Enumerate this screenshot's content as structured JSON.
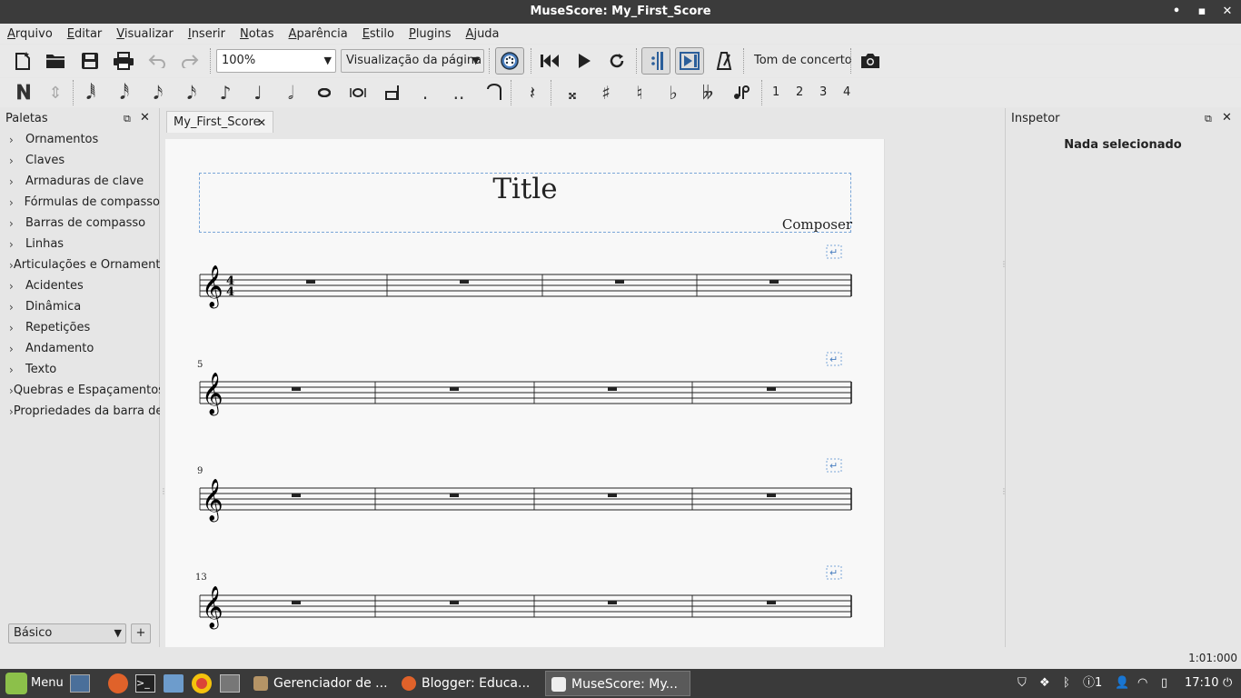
{
  "window": {
    "title": "MuseScore: My_First_Score",
    "minimize": "•",
    "maximize": "▪",
    "close": "✕"
  },
  "menu": [
    "Arquivo",
    "Editar",
    "Visualizar",
    "Inserir",
    "Notas",
    "Aparência",
    "Estilo",
    "Plugins",
    "Ajuda"
  ],
  "toolbar": {
    "zoom": "100%",
    "view_mode": "Visualização da página",
    "concert_pitch": "Tom de concerto"
  },
  "note_input": {
    "voices": [
      "1",
      "2",
      "3",
      "4"
    ]
  },
  "palettes": {
    "title": "Paletas",
    "items": [
      "Ornamentos",
      "Claves",
      "Armaduras de clave",
      "Fórmulas de compasso",
      "Barras de compasso",
      "Linhas",
      "Articulações e Ornamentos",
      "Acidentes",
      "Dinâmica",
      "Repetições",
      "Andamento",
      "Texto",
      "Quebras e Espaçamentos",
      "Propriedades da barra de compasso"
    ],
    "workspace": "Básico",
    "add": "+"
  },
  "score_tab": {
    "label": "My_First_Score",
    "close": "✕"
  },
  "score": {
    "title": "Title",
    "composer": "Composer",
    "systems": [
      {
        "measure_number": ""
      },
      {
        "measure_number": "5"
      },
      {
        "measure_number": "9"
      },
      {
        "measure_number": "13"
      }
    ]
  },
  "inspector": {
    "title": "Inspetor",
    "empty_text": "Nada selecionado"
  },
  "status": {
    "time": "1:01:000"
  },
  "taskbar": {
    "menu_label": "Menu",
    "tasks": [
      "Gerenciador de ...",
      "Blogger: Educa...",
      "MuseScore: My..."
    ],
    "clock": "17:10",
    "notification_count": "1"
  },
  "colors": {
    "titlebar": "#3b3b3b",
    "accent": "#4a7fc0",
    "taskbar": "#3a3a3a"
  }
}
